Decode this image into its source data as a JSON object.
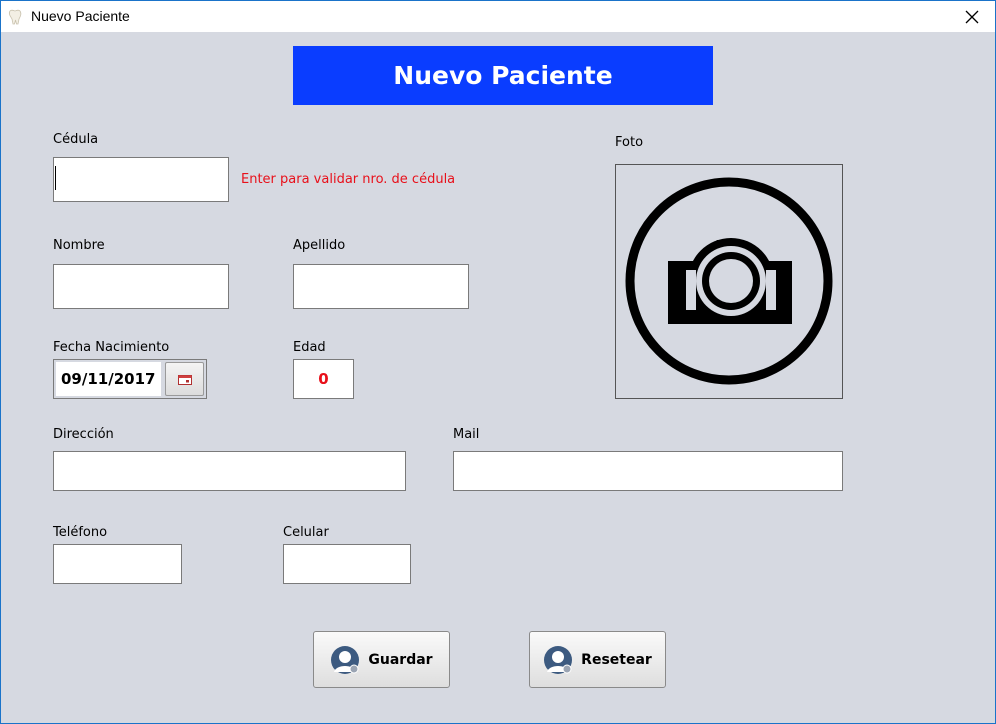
{
  "window": {
    "title": "Nuevo Paciente"
  },
  "header": {
    "title": "Nuevo Paciente"
  },
  "form": {
    "cedula": {
      "label": "Cédula",
      "value": "",
      "hint": "Enter para validar nro. de cédula"
    },
    "nombre": {
      "label": "Nombre",
      "value": ""
    },
    "apellido": {
      "label": "Apellido",
      "value": ""
    },
    "fecha_nacimiento": {
      "label": "Fecha Nacimiento",
      "value": "09/11/2017"
    },
    "edad": {
      "label": "Edad",
      "value": "0"
    },
    "direccion": {
      "label": "Dirección",
      "value": ""
    },
    "mail": {
      "label": "Mail",
      "value": ""
    },
    "telefono": {
      "label": "Teléfono",
      "value": ""
    },
    "celular": {
      "label": "Celular",
      "value": ""
    }
  },
  "photo": {
    "label": "Foto",
    "icon": "camera-icon"
  },
  "buttons": {
    "save_label": "Guardar",
    "reset_label": "Resetear",
    "icon": "user-icon"
  },
  "colors": {
    "banner": "#0a3dff",
    "hint": "#e8101a",
    "background": "#d6d9e1"
  }
}
